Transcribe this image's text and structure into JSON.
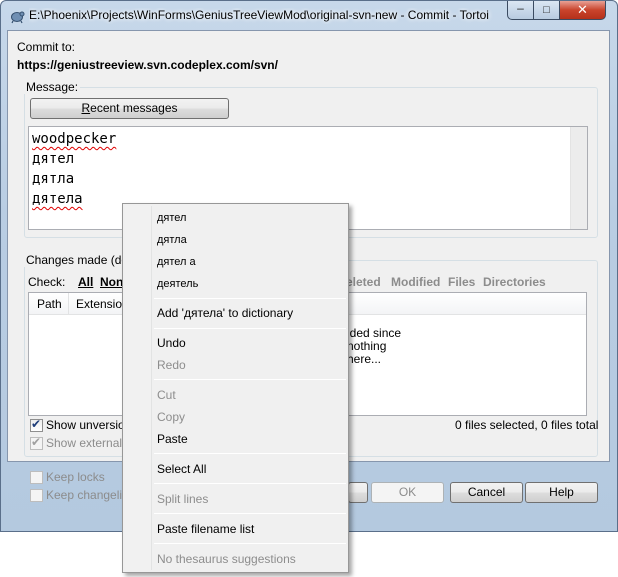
{
  "window": {
    "title": "E:\\Phoenix\\Projects\\WinForms\\GeniusTreeViewMod\\original-svn-new - Commit - Tortoi",
    "minimize_glyph": "–",
    "maximize_glyph": "□",
    "close_glyph": "✕"
  },
  "commit": {
    "to_label": "Commit to:",
    "url": "https://geniustreeview.svn.codeplex.com/svn/"
  },
  "message": {
    "legend": "Message:",
    "recent_button_accel": "R",
    "recent_button_rest": "ecent messages",
    "lines": [
      "woodpecker",
      "дятел",
      "дятла",
      "дятела"
    ]
  },
  "changes": {
    "legend": "Changes made (dou",
    "check_label": "Check:",
    "check_all": "All",
    "check_none": "Non",
    "filters": [
      "eleted",
      "Modified",
      "Files",
      "Directories"
    ],
    "columns": [
      "Path",
      "Extension"
    ],
    "empty_lines": [
      "lded since",
      "nothing",
      "here..."
    ],
    "summary": "0 files selected, 0 files total"
  },
  "options": {
    "show_unversioned": {
      "label": "Show unversione",
      "checked": true
    },
    "show_externals": {
      "label": "Show externals",
      "checked": true
    },
    "keep_locks": {
      "label": "Keep locks",
      "checked": false
    },
    "keep_changelists": {
      "label": "Keep changelists",
      "checked": false
    }
  },
  "buttons": {
    "ok": "OK",
    "cancel": "Cancel",
    "help": "Help"
  },
  "context_menu": {
    "suggestions": [
      "дятел",
      "дятла",
      "дятел а",
      "деятель"
    ],
    "add_to_dictionary": "Add 'дятела' to dictionary",
    "undo": "Undo",
    "redo": "Redo",
    "cut": "Cut",
    "copy": "Copy",
    "paste": "Paste",
    "select_all": "Select All",
    "split_lines": "Split lines",
    "paste_filename_list": "Paste filename list",
    "no_thesaurus": "No thesaurus suggestions"
  }
}
